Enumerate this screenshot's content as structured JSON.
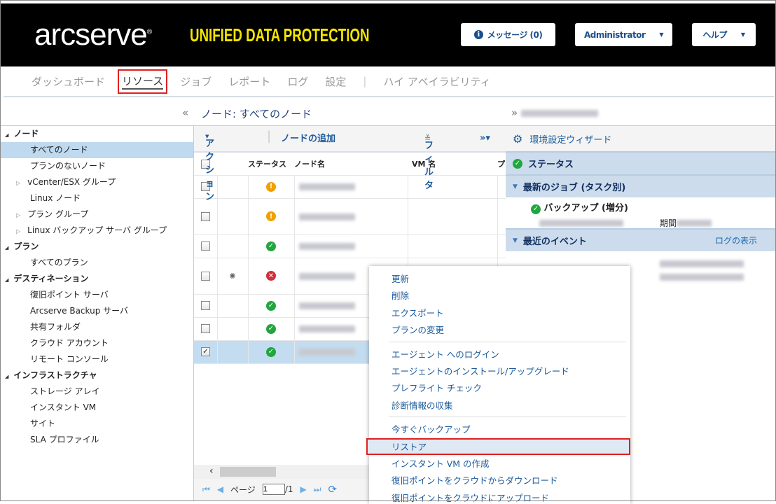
{
  "header": {
    "logo": "arcserve",
    "tagline": "UNIFIED DATA PROTECTION",
    "messages": "メッセージ (0)",
    "user": "Administrator",
    "help": "ヘルプ"
  },
  "nav": [
    "ダッシュボード",
    "リソース",
    "ジョブ",
    "レポート",
    "ログ",
    "設定",
    "ハイ アベイラビリティ"
  ],
  "breadcrumb": "ノード: すべてのノード",
  "tree": [
    {
      "label": "ノード",
      "type": "g"
    },
    {
      "label": "すべてのノード",
      "type": "c",
      "selected": true
    },
    {
      "label": "プランのないノード",
      "type": "c"
    },
    {
      "label": "vCenter/ESX グループ",
      "type": "e"
    },
    {
      "label": "Linux ノード",
      "type": "c"
    },
    {
      "label": "プラン グループ",
      "type": "e"
    },
    {
      "label": "Linux バックアップ サーバ グループ",
      "type": "e"
    },
    {
      "label": "プラン",
      "type": "g"
    },
    {
      "label": "すべてのプラン",
      "type": "c"
    },
    {
      "label": "デスティネーション",
      "type": "g"
    },
    {
      "label": "復旧ポイント サーバ",
      "type": "c"
    },
    {
      "label": "Arcserve Backup サーバ",
      "type": "c"
    },
    {
      "label": "共有フォルダ",
      "type": "c"
    },
    {
      "label": "クラウド アカウント",
      "type": "c"
    },
    {
      "label": "リモート コンソール",
      "type": "c"
    },
    {
      "label": "インフラストラクチャ",
      "type": "g"
    },
    {
      "label": "ストレージ アレイ",
      "type": "c"
    },
    {
      "label": "インスタント VM",
      "type": "c"
    },
    {
      "label": "サイト",
      "type": "c"
    },
    {
      "label": "SLA プロファイル",
      "type": "c"
    }
  ],
  "toolbar": {
    "action": "アクション",
    "add_node": "ノードの追加",
    "filter": "フィルタ"
  },
  "table": {
    "columns": [
      "ステータス",
      "ノード名",
      "VM 名",
      "プ"
    ],
    "rows": [
      {
        "status": "warn"
      },
      {
        "status": "warn",
        "tall": true
      },
      {
        "status": "ok"
      },
      {
        "status": "err",
        "tall": true,
        "loading": true
      },
      {
        "status": "ok"
      },
      {
        "status": "ok"
      },
      {
        "status": "ok",
        "checked": true
      }
    ]
  },
  "pager": {
    "page_label": "ページ",
    "page": "1",
    "total": "/1"
  },
  "right": {
    "wizard": "環境設定ウィザード",
    "status": "ステータス",
    "latest_jobs": "最新のジョブ (タスク別)",
    "job": "バックアップ (増分)",
    "period": "期間",
    "recent_events": "最近のイベント",
    "view_log": "ログの表示"
  },
  "menu": {
    "groups": [
      [
        "更新",
        "削除",
        "エクスポート",
        "プランの変更"
      ],
      [
        "エージェント へのログイン",
        "エージェントのインストール/アップグレード",
        "プレフライト チェック",
        "診断情報の収集"
      ],
      [
        "今すぐバックアップ",
        "リストア",
        "インスタント VM の作成",
        "復旧ポイントをクラウドからダウンロード",
        "復旧ポイントをクラウドにアップロード"
      ]
    ],
    "highlighted": "リストア"
  }
}
